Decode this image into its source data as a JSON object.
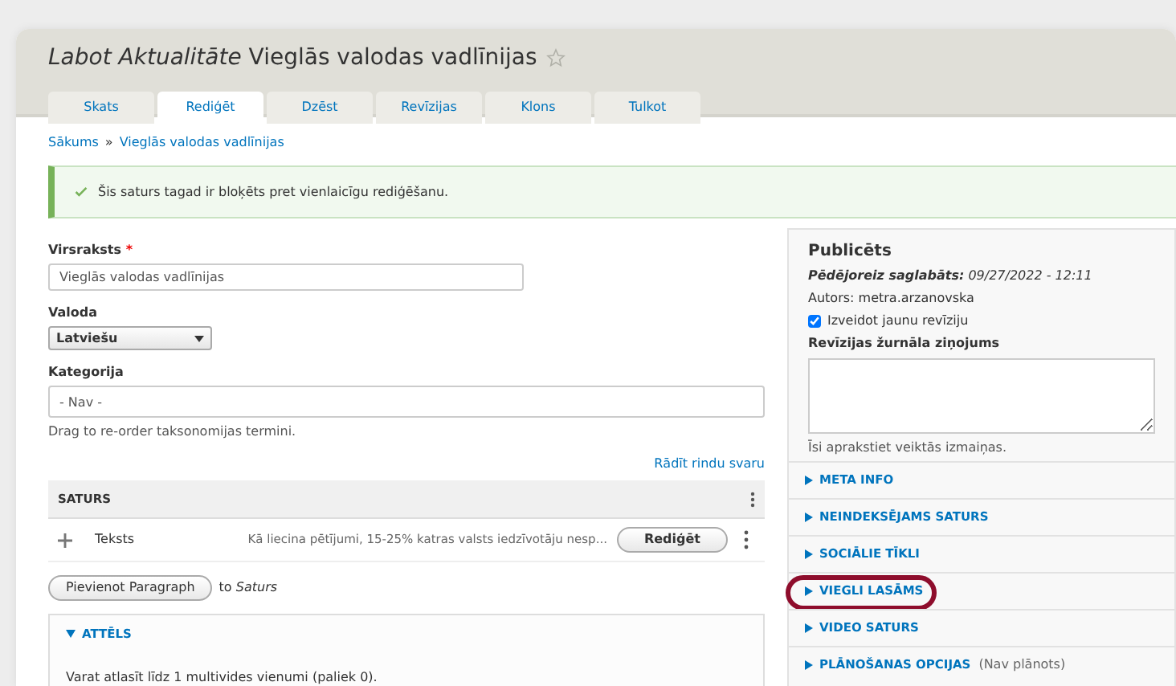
{
  "page_title": {
    "prefix": "Labot Aktualitāte",
    "title": "Vieglās valodas vadlīnijas",
    "starred": false
  },
  "tabs": [
    {
      "label": "Skats",
      "selected": false
    },
    {
      "label": "Rediģēt",
      "selected": true
    },
    {
      "label": "Dzēst",
      "selected": false
    },
    {
      "label": "Revīzijas",
      "selected": false
    },
    {
      "label": "Klons",
      "selected": false
    },
    {
      "label": "Tulkot",
      "selected": false
    }
  ],
  "breadcrumb": {
    "items": [
      "Sākums",
      "Vieglās valodas vadlīnijas"
    ],
    "separator": "»"
  },
  "message": {
    "kind": "status",
    "text": "Šis saturs tagad ir bloķēts pret vienlaicīgu rediģēšanu."
  },
  "fields": {
    "title": {
      "label": "Virsraksts",
      "required": true,
      "required_marker": "*",
      "value": "Vieglās valodas vadlīnijas"
    },
    "language": {
      "label": "Valoda",
      "value": "Latviešu"
    },
    "category": {
      "label": "Kategorija",
      "value": "- Nav -",
      "description": "Drag to re-order taksonomijas termini."
    }
  },
  "show_weights": "Rādīt rindu svaru",
  "paragraphs": {
    "heading": "SATURS",
    "rows": [
      {
        "type": "Teksts",
        "summary": "Kā liecina pētījumi, 15-25% katras valsts iedzīvotāju nesp...",
        "button": "Rediģēt"
      }
    ],
    "add_button": "Pievienot Paragraph",
    "add_suffix": "to *Saturs*"
  },
  "image_section": {
    "title": "ATTĒLS",
    "expanded": true,
    "hint": "Varat atlasīt līdz 1 multivides vienumi (paliek 0)."
  },
  "sidebar": {
    "status": "Publicēts",
    "last_saved": "**Pēdējoreiz saglabāts:** 09/27/2022 - 12:11",
    "author": "Autors: metra.arzanovska",
    "new_revision": {
      "label": "Izveidot jaunu revīziju",
      "checked": true
    },
    "log": {
      "label": "Revīzijas žurnāla ziņojums",
      "hint": "Īsi aprakstiet veiktās izmaiņas."
    },
    "sections": [
      {
        "title": "META INFO",
        "expanded": false,
        "highlighted": false
      },
      {
        "title": "NEINDEKSĒJAMS SATURS",
        "expanded": false,
        "highlighted": false
      },
      {
        "title": "SOCIĀLIE TĪKLI",
        "expanded": false,
        "highlighted": false
      },
      {
        "title": "VIEGLI LASĀMS",
        "expanded": false,
        "highlighted": true
      },
      {
        "title": "VIDEO SATURS",
        "expanded": false,
        "highlighted": false
      },
      {
        "title": "PLĀNOŠANAS OPCIJAS",
        "note": "(Nav plānots)",
        "expanded": false,
        "highlighted": false
      }
    ]
  }
}
